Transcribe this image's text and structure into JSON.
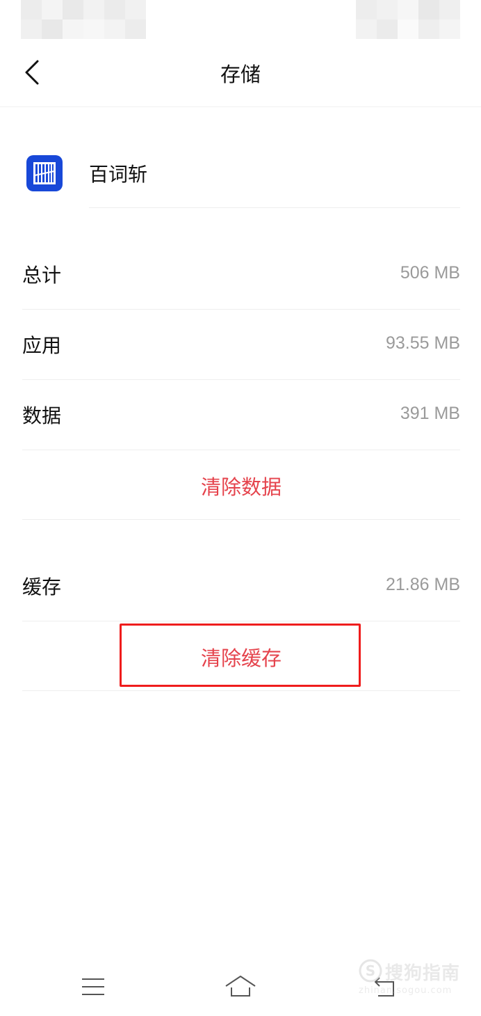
{
  "header": {
    "title": "存储"
  },
  "app": {
    "name": "百词斩",
    "icon": "baicizhan-app-icon",
    "icon_color": "#1848d8"
  },
  "storage": {
    "rows": [
      {
        "label": "总计",
        "value": "506 MB"
      },
      {
        "label": "应用",
        "value": "93.55 MB"
      },
      {
        "label": "数据",
        "value": "391 MB"
      }
    ],
    "clear_data_label": "清除数据",
    "cache": {
      "label": "缓存",
      "value": "21.86 MB"
    },
    "clear_cache_label": "清除缓存"
  },
  "bottom_nav": {
    "icons": [
      "menu-icon",
      "home-icon",
      "back-return-icon"
    ]
  },
  "watermark": {
    "text": "搜狗指南",
    "url": "zhinan.sogou.com"
  },
  "colors": {
    "accent_red": "#e5434c",
    "highlight": "#ef1c1c",
    "value_gray": "#9a9a9a"
  }
}
